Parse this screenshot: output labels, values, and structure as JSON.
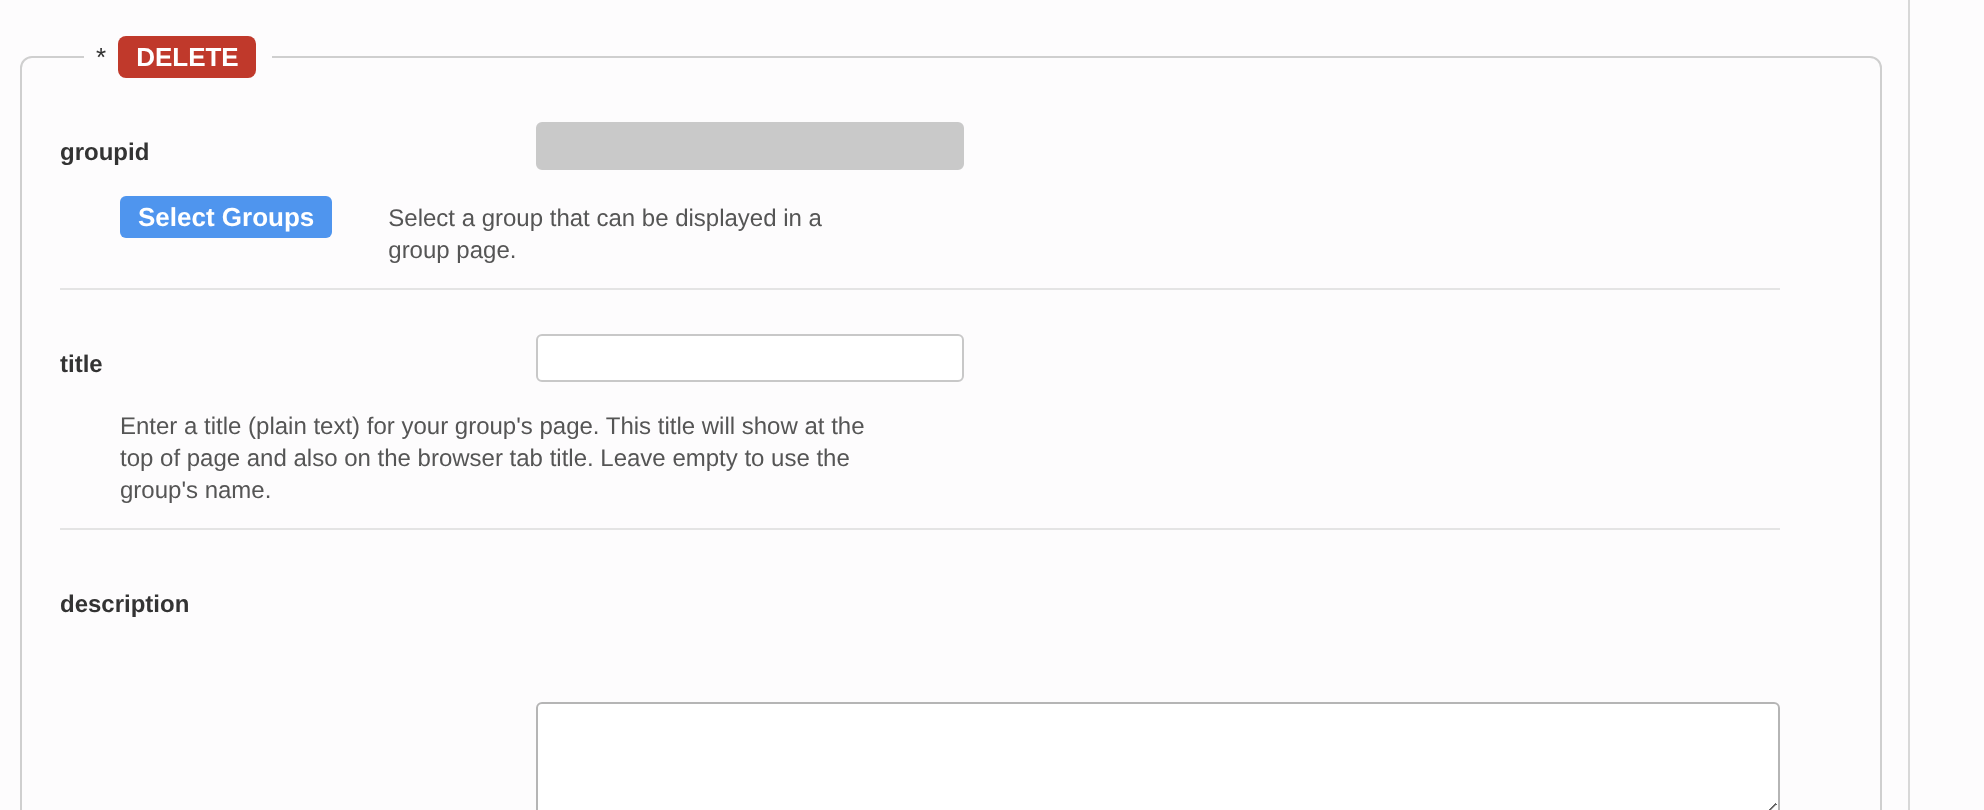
{
  "legend": {
    "required_mark": "*",
    "badge": "DELETE"
  },
  "fields": [
    {
      "kind": "picker",
      "label": "groupid",
      "disabled": true,
      "button": "Select Groups",
      "help": "Select a group that can be displayed in a group page."
    },
    {
      "kind": "text",
      "label": "title",
      "disabled": false,
      "help": "Enter a title (plain text) for your group's page. This title will show at the top of page and also on the browser tab title. Leave empty to use the group's name."
    },
    {
      "kind": "textarea",
      "label": "description"
    }
  ]
}
